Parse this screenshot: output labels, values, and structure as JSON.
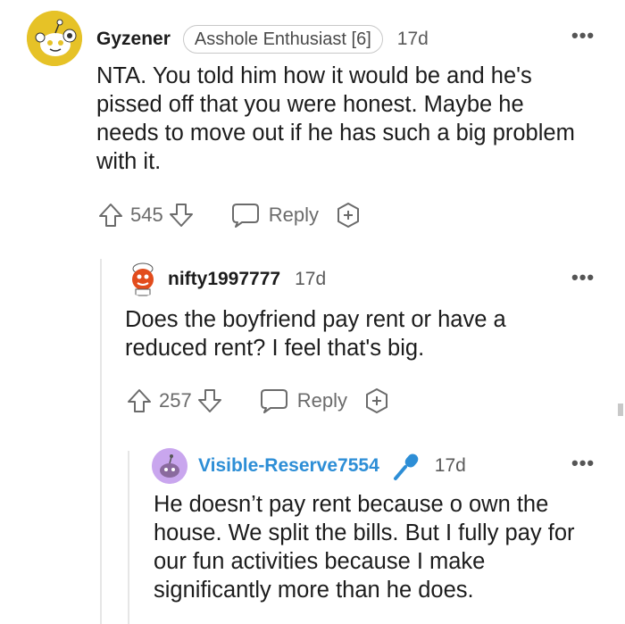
{
  "comments": [
    {
      "username": "Gyzener",
      "flair": "Asshole Enthusiast [6]",
      "time": "17d",
      "text": "NTA. You told him how it would be and he's pissed off that you were honest. Maybe he needs to move out if he has such a big problem with it.",
      "votes": "545",
      "reply_label": "Reply",
      "avatar_icon": "reddit-snoo-avatar-yellow"
    },
    {
      "username": "nifty1997777",
      "time": "17d",
      "text": "Does the boyfriend pay rent or have a reduced rent? I feel that's big.",
      "votes": "257",
      "reply_label": "Reply",
      "avatar_icon": "snoo-avatar-chef"
    },
    {
      "username": "Visible-Reserve7554",
      "time": "17d",
      "text": "He doesn’t pay rent because o own the house. We split the bills. But I fully pay for our fun activities because I make significantly more than he does.",
      "avatar_icon": "snoo-avatar-purple",
      "op_icon": "microphone-icon"
    }
  ],
  "colors": {
    "op_username": "#2d8ed6",
    "mic": "#2d8ed6",
    "avatar_yellow": "#e6c227",
    "avatar_purple": "#c9a6ee",
    "icon_gray": "#6b6b6b"
  }
}
